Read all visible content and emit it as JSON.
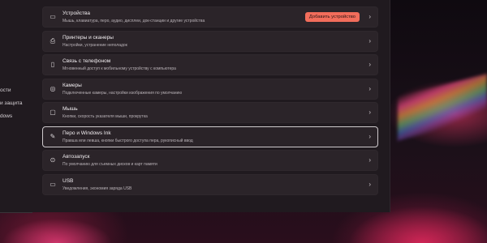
{
  "nav": {
    "items": [
      "ости",
      "и защита",
      "dows"
    ]
  },
  "devices": {
    "title": "Устройства",
    "desc": "Мышь, клавиатура, перо, аудио, дисплеи, док-станции и другие устройства",
    "add_button": "Добавить устройство"
  },
  "cards": [
    {
      "title": "Принтеры и сканеры",
      "desc": "Настройки, устранение неполадок",
      "icon": "printer-icon"
    },
    {
      "title": "Связь с телефоном",
      "desc": "Мгновенный доступ к мобильному устройству с компьютера",
      "icon": "phone-icon"
    },
    {
      "title": "Камеры",
      "desc": "Подключенные камеры, настройки изображения по умолчанию",
      "icon": "camera-icon"
    },
    {
      "title": "Мышь",
      "desc": "Кнопки, скорость указателя мыши, прокрутка",
      "icon": "mouse-icon"
    },
    {
      "title": "Перо и Windows Ink",
      "desc": "Правша или левша, кнопки быстрого доступа пера, рукописный ввод",
      "icon": "pen-icon"
    },
    {
      "title": "Автозапуск",
      "desc": "По умолчанию для съемных дисков и карт памяти",
      "icon": "autoplay-icon"
    },
    {
      "title": "USB",
      "desc": "Уведомления, экономия заряда USB",
      "icon": "usb-icon"
    }
  ],
  "chevron": "›",
  "colors": {
    "accent": "#f26d5b",
    "card": "#2b2429",
    "window": "#201a1f"
  }
}
